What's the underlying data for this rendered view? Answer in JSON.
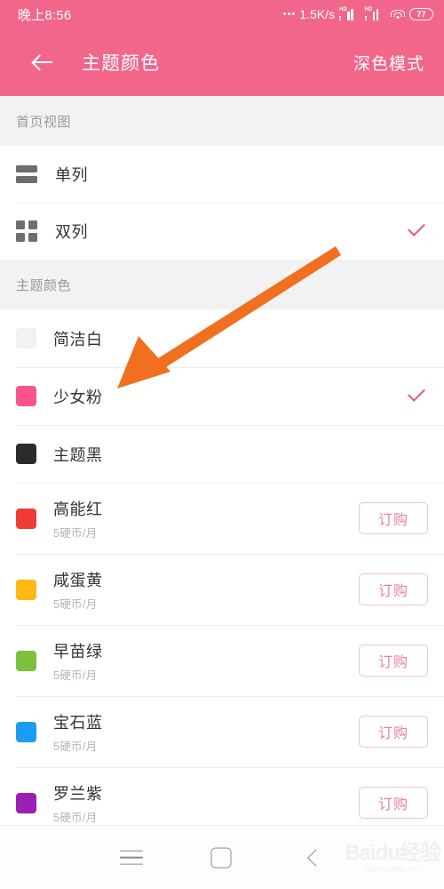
{
  "status_bar": {
    "time": "晚上8:56",
    "network_speed": "1.5K/s",
    "hd_label": "HD",
    "battery_level": "77",
    "icons": [
      "signal-icon",
      "signal-icon",
      "wifi-icon",
      "battery-icon"
    ]
  },
  "app_bar": {
    "back_icon": "back-arrow-icon",
    "title": "主题颜色",
    "action_label": "深色模式",
    "background_color": "#f2668b"
  },
  "sections": [
    {
      "header": "首页视图",
      "rows": [
        {
          "icon": "single-column-icon",
          "label": "单列",
          "checked": false
        },
        {
          "icon": "double-column-icon",
          "label": "双列",
          "checked": true
        }
      ]
    },
    {
      "header": "主题颜色",
      "rows": [
        {
          "swatch": "#f2f2f2",
          "label": "简洁白",
          "checked": false
        },
        {
          "swatch": "#f9548c",
          "label": "少女粉",
          "checked": true
        },
        {
          "swatch": "#2b2b2b",
          "label": "主题黑",
          "checked": false
        },
        {
          "swatch": "#ef3b36",
          "label": "高能红",
          "price": "5硬币/月",
          "button": "订购"
        },
        {
          "swatch": "#fbb911",
          "label": "咸蛋黄",
          "price": "5硬币/月",
          "button": "订购"
        },
        {
          "swatch": "#7cc13c",
          "label": "早苗绿",
          "price": "5硬币/月",
          "button": "订购"
        },
        {
          "swatch": "#1b9cf0",
          "label": "宝石蓝",
          "price": "5硬币/月",
          "button": "订购"
        },
        {
          "swatch": "#9b1fb5",
          "label": "罗兰紫",
          "price": "5硬币/月",
          "button": "订购"
        }
      ]
    }
  ],
  "nav_bar": {
    "menu_icon": "menu-icon",
    "home_icon": "home-square-icon",
    "back_icon": "chevron-left-icon",
    "watermark": "Baidu经验",
    "watermark_sub": "jingyan.baidu.com"
  },
  "annotation": {
    "arrow_color": "#f07020",
    "points_at": "少女粉"
  },
  "colors": {
    "accent_pink": "#f2668b",
    "check_pink": "#e05a86",
    "section_bg": "#f2f2f2",
    "divider": "#ededed",
    "label_text": "#333333",
    "sub_text": "#b4b4b4"
  }
}
